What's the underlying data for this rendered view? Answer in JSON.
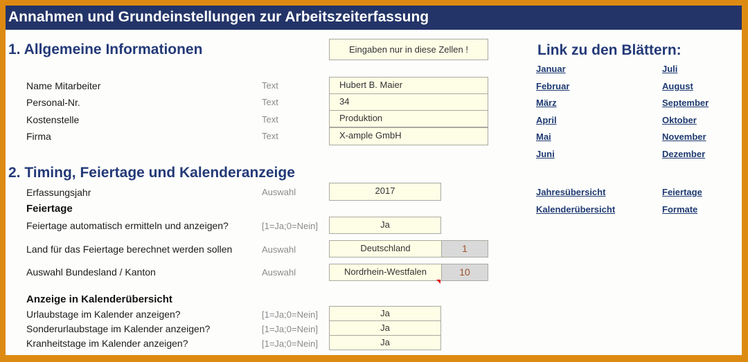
{
  "title": "Annahmen und Grundeinstellungen zur Arbeitszeiterfassung",
  "section1": {
    "heading": "1.  Allgemeine Informationen",
    "input_note": "Eingaben nur in diese Zellen !",
    "rows": [
      {
        "label": "Name Mitarbeiter",
        "type": "Text",
        "value": "Hubert B. Maier"
      },
      {
        "label": "Personal-Nr.",
        "type": "Text",
        "value": "34"
      },
      {
        "label": "Kostenstelle",
        "type": "Text",
        "value": "Produktion"
      },
      {
        "label": "Firma",
        "type": "Text",
        "value": "X-ample GmbH"
      }
    ]
  },
  "section2": {
    "heading": "2.  Timing, Feiertage und Kalenderanzeige",
    "year": {
      "label": "Erfassungsjahr",
      "type": "Auswahl",
      "value": "2017"
    },
    "holidays_heading": "Feiertage",
    "auto_holidays": {
      "label": "Feiertage automatisch ermitteln und anzeigen?",
      "type": "[1=Ja;0=Nein]",
      "value": "Ja"
    },
    "country": {
      "label": "Land für das Feiertage berechnet werden sollen",
      "type": "Auswahl",
      "value": "Deutschland",
      "code": "1"
    },
    "state": {
      "label": "Auswahl Bundesland / Kanton",
      "type": "Auswahl",
      "value": "Nordrhein-Westfalen",
      "code": "10"
    },
    "calendar_heading": "Anzeige in Kalenderübersicht",
    "calendar_rows": [
      {
        "label": "Urlaubstage im Kalender anzeigen?",
        "type": "[1=Ja;0=Nein]",
        "value": "Ja"
      },
      {
        "label": "Sonderurlaubstage im Kalender anzeigen?",
        "type": "[1=Ja;0=Nein]",
        "value": "Ja"
      },
      {
        "label": "Kranheitstage im Kalender anzeigen?",
        "type": "[1=Ja;0=Nein]",
        "value": "Ja"
      }
    ]
  },
  "links": {
    "heading": "Link zu den Blättern:",
    "months_left": [
      "Januar",
      "Februar",
      "März",
      "April",
      "Mai",
      "Juni"
    ],
    "months_right": [
      "Juli",
      "August",
      "September",
      "Oktober",
      "November",
      "Dezember"
    ],
    "extra_left": [
      "Jahresübersicht",
      "Kalenderübersicht"
    ],
    "extra_right": [
      "Feiertage",
      "Formate"
    ]
  },
  "colors": {
    "frame": "#dd8a12",
    "titlebar": "#233468",
    "heading": "#243a78",
    "input_cell": "#fefee6",
    "code_cell": "#d9d9d9"
  }
}
